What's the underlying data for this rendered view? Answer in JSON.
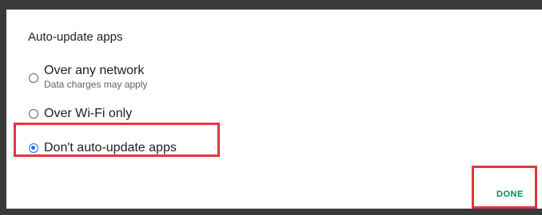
{
  "dialog": {
    "title": "Auto-update apps",
    "options": [
      {
        "label": "Over any network",
        "sublabel": "Data charges may apply",
        "selected": false
      },
      {
        "label": "Over Wi-Fi only",
        "selected": false
      },
      {
        "label": "Don't auto-update apps",
        "selected": true
      }
    ],
    "done_label": "DONE"
  },
  "colors": {
    "accent": "#1a73e8",
    "done_text": "#01875f",
    "highlight": "#e0383e"
  }
}
